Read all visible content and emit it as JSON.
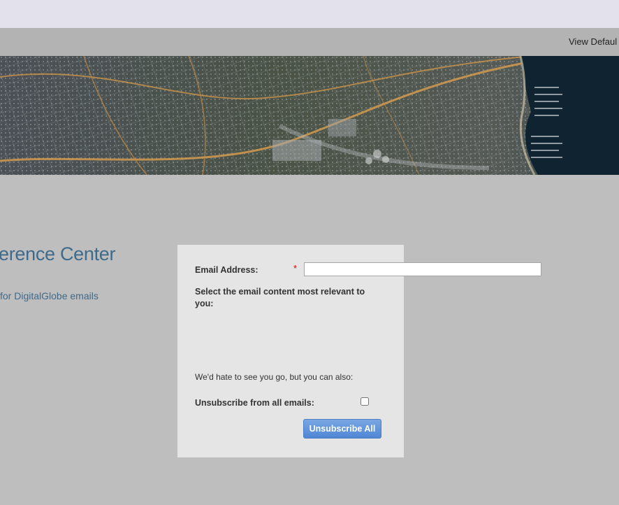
{
  "nav": {
    "view_default_label": "View Defaul"
  },
  "banner": {
    "alt": "aerial-map-banner"
  },
  "page": {
    "heading": "erence Center",
    "subheading": "for DigitalGlobe emails"
  },
  "form": {
    "email_label": "Email Address:",
    "required_marker": "*",
    "email_value": "",
    "content_prompt": "Select the email content most relevant to you:",
    "leave_note": "We'd hate to see you go, but you can also:",
    "unsubscribe_label": "Unsubscribe from all emails:",
    "unsubscribe_checked": false,
    "unsubscribe_button": "Unsubscribe All"
  },
  "colors": {
    "page_bg": "#bebebe",
    "top_strip": "#e3e2ec",
    "nav_bar": "#b3b3b3",
    "panel_bg": "#e5e5e5",
    "heading_text": "#3f6a8a",
    "required": "#d40000",
    "button": "#5b8fd8"
  }
}
